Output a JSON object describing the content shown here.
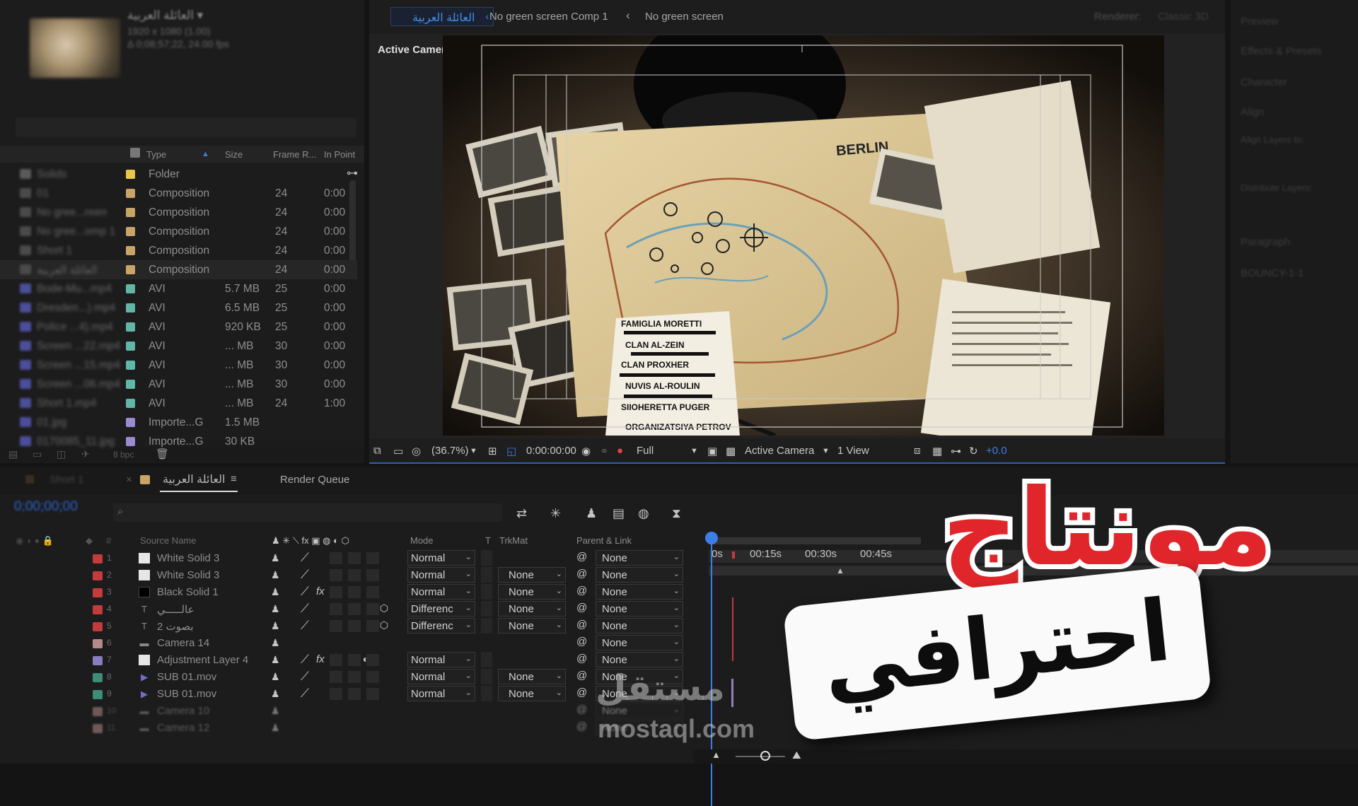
{
  "project": {
    "title": "العائلة العربية ▾",
    "meta_resolution": "1920 x 1080 (1.00)",
    "meta_duration": "Δ 0;08;57;22, 24.00 fps",
    "columns": {
      "type": "Type",
      "size": "Size",
      "frame_rate": "Frame R...",
      "in_point": "In Point"
    },
    "rows": [
      {
        "name": "Solids",
        "type": "Folder",
        "size": "",
        "fr": "",
        "in": "",
        "label": "#e8c84a",
        "icon": "#5a5a5a"
      },
      {
        "name": "01",
        "type": "Composition",
        "size": "",
        "fr": "24",
        "in": "0:00",
        "label": "#c9a469",
        "icon": "#4a4a4a"
      },
      {
        "name": "No gree...reen",
        "type": "Composition",
        "size": "",
        "fr": "24",
        "in": "0:00",
        "label": "#c9a469",
        "icon": "#4a4a4a"
      },
      {
        "name": "No gree...omp 1",
        "type": "Composition",
        "size": "",
        "fr": "24",
        "in": "0:00",
        "label": "#c9a469",
        "icon": "#4a4a4a"
      },
      {
        "name": "Short 1",
        "type": "Composition",
        "size": "",
        "fr": "24",
        "in": "0:00",
        "label": "#c9a469",
        "icon": "#4a4a4a"
      },
      {
        "name": "العائلة العربية",
        "type": "Composition",
        "size": "",
        "fr": "24",
        "in": "0:00",
        "label": "#c9a469",
        "icon": "#4a4a4a"
      },
      {
        "name": "Bode-Mu...mp4",
        "type": "AVI",
        "size": "5.7 MB",
        "fr": "25",
        "in": "0:00",
        "label": "#62b6a8",
        "icon": "#4b4e9a"
      },
      {
        "name": "Dresden...).mp4",
        "type": "AVI",
        "size": "6.5 MB",
        "fr": "25",
        "in": "0:00",
        "label": "#62b6a8",
        "icon": "#4b4e9a"
      },
      {
        "name": "Police ...4).mp4",
        "type": "AVI",
        "size": "920 KB",
        "fr": "25",
        "in": "0:00",
        "label": "#62b6a8",
        "icon": "#4b4e9a"
      },
      {
        "name": "Screen ...22.mp4",
        "type": "AVI",
        "size": "... MB",
        "fr": "30",
        "in": "0:00",
        "label": "#62b6a8",
        "icon": "#4b4e9a"
      },
      {
        "name": "Screen ...15.mp4",
        "type": "AVI",
        "size": "... MB",
        "fr": "30",
        "in": "0:00",
        "label": "#62b6a8",
        "icon": "#4b4e9a"
      },
      {
        "name": "Screen ...06.mp4",
        "type": "AVI",
        "size": "... MB",
        "fr": "30",
        "in": "0:00",
        "label": "#62b6a8",
        "icon": "#4b4e9a"
      },
      {
        "name": "Short 1.mp4",
        "type": "AVI",
        "size": "... MB",
        "fr": "24",
        "in": "1:00",
        "label": "#62b6a8",
        "icon": "#4b4e9a"
      },
      {
        "name": "01.jpg",
        "type": "Importe...G",
        "size": "1.5 MB",
        "fr": "",
        "in": "",
        "label": "#9b8ad0",
        "icon": "#4b4e9a"
      },
      {
        "name": "0170085_11.jpg",
        "type": "Importe...G",
        "size": "30 KB",
        "fr": "",
        "in": "",
        "label": "#9b8ad0",
        "icon": "#4b4e9a"
      }
    ],
    "footer_bpc": "8 bpc"
  },
  "viewer": {
    "comp_tab": "العائلة العربية",
    "breadcrumb_1": "No green screen Comp 1",
    "breadcrumb_2": "No green screen",
    "renderer": "Renderer:",
    "renderer_value": "Classic 3D",
    "active_camera_label": "Active Camera",
    "zoom": "(36.7%)",
    "timecode": "0:00:00:00",
    "resolution": "Full",
    "camera_select": "Active Camera",
    "views_select": "1 View",
    "exposure": "+0.0"
  },
  "scene": {
    "map_title": "BERLIN",
    "note_lines": [
      "FAMIGLIA MORETTI",
      "CLAN AL-ZEIN",
      "CLAN PROXHER",
      "NUVIS AL-ROULIN",
      "SIIOHERETTA PUGER",
      "ORGANIZATSIYA PETROV"
    ]
  },
  "right_panel": {
    "items": [
      "Preview",
      "Effects & Presets",
      "Character",
      "Align",
      "Align Layers to:",
      "Distribute Layers:",
      "Paragraph",
      "BOUNCY-1-1"
    ]
  },
  "timeline": {
    "tab_short": "Short 1",
    "tab_active": "العائلة العربية",
    "tab_render": "Render Queue",
    "current_time": "0;00;00;00",
    "columns": {
      "source_name": "Source Name",
      "mode": "Mode",
      "t": "T",
      "trkmat": "TrkMat",
      "parent": "Parent & Link"
    },
    "layers": [
      {
        "num": "1",
        "icon": "solid-white",
        "name": "White Solid 3",
        "label": "#c43b3b",
        "mode": "Normal",
        "trkmat": "",
        "parent": "None",
        "fx": false,
        "cube": false
      },
      {
        "num": "2",
        "icon": "solid-white",
        "name": "White Solid 3",
        "label": "#c43b3b",
        "mode": "Normal",
        "trkmat": "None",
        "parent": "None",
        "fx": false,
        "cube": false
      },
      {
        "num": "3",
        "icon": "solid-black",
        "name": "Black Solid 1",
        "label": "#c43b3b",
        "mode": "Normal",
        "trkmat": "None",
        "parent": "None",
        "fx": true,
        "cube": false
      },
      {
        "num": "4",
        "icon": "text",
        "name": "عالـــــي",
        "label": "#c43b3b",
        "mode": "Differenc",
        "trkmat": "None",
        "parent": "None",
        "fx": false,
        "cube": true
      },
      {
        "num": "5",
        "icon": "text",
        "name": "2 بصوت",
        "label": "#c43b3b",
        "mode": "Differenc",
        "trkmat": "None",
        "parent": "None",
        "fx": false,
        "cube": true
      },
      {
        "num": "6",
        "icon": "camera",
        "name": "Camera 14",
        "label": "#b68a8a",
        "mode": "",
        "trkmat": "",
        "parent": "None",
        "fx": false,
        "cube": false
      },
      {
        "num": "7",
        "icon": "solid-white",
        "name": "Adjustment Layer 4",
        "label": "#8a7cc1",
        "mode": "Normal",
        "trkmat": "",
        "parent": "None",
        "fx": true,
        "cube": false
      },
      {
        "num": "8",
        "icon": "footage",
        "name": "SUB 01.mov",
        "label": "#3e8d79",
        "mode": "Normal",
        "trkmat": "None",
        "parent": "None",
        "fx": false,
        "cube": false
      },
      {
        "num": "9",
        "icon": "footage",
        "name": "SUB 01.mov",
        "label": "#3e8d79",
        "mode": "Normal",
        "trkmat": "None",
        "parent": "None",
        "fx": false,
        "cube": false
      },
      {
        "num": "10",
        "icon": "camera",
        "name": "Camera 10",
        "label": "#b68a8a",
        "mode": "",
        "trkmat": "",
        "parent": "None",
        "fx": false,
        "cube": false
      },
      {
        "num": "11",
        "icon": "camera",
        "name": "Camera 12",
        "label": "#b68a8a",
        "mode": "",
        "trkmat": "",
        "parent": "None",
        "fx": false,
        "cube": false
      }
    ],
    "ruler_labels": [
      "0s",
      "00:15s",
      "00:30s",
      "00:45s"
    ]
  },
  "overlay": {
    "title_red": "مونتاج",
    "badge_text": "احترافي",
    "watermark_ar": "مستقل",
    "watermark_en": "mostaql.com",
    "red_color": "#e0262b"
  }
}
